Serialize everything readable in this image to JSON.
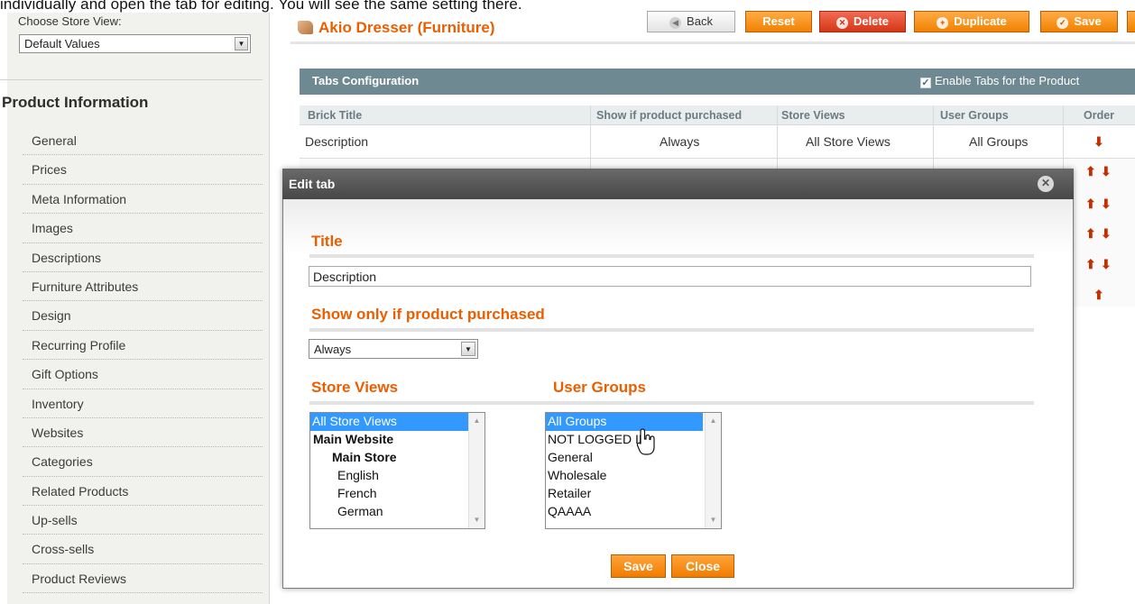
{
  "caption": "individually and open the tab for editing. You will see the same setting there.",
  "sidebar": {
    "store_view_label": "Choose Store View:",
    "store_view_value": "Default Values",
    "section_title": "Product Information",
    "items": [
      {
        "label": "General"
      },
      {
        "label": "Prices"
      },
      {
        "label": "Meta Information"
      },
      {
        "label": "Images"
      },
      {
        "label": "Descriptions"
      },
      {
        "label": "Furniture Attributes"
      },
      {
        "label": "Design"
      },
      {
        "label": "Recurring Profile"
      },
      {
        "label": "Gift Options"
      },
      {
        "label": "Inventory"
      },
      {
        "label": "Websites"
      },
      {
        "label": "Categories"
      },
      {
        "label": "Related Products"
      },
      {
        "label": "Up-sells"
      },
      {
        "label": "Cross-sells"
      },
      {
        "label": "Product Reviews"
      }
    ]
  },
  "header": {
    "product_title": "Akio Dresser (Furniture)",
    "buttons": {
      "back": "Back",
      "reset": "Reset",
      "delete": "Delete",
      "duplicate": "Duplicate",
      "save": "Save"
    }
  },
  "tabs_config": {
    "title": "Tabs Configuration",
    "enable_label": "Enable Tabs for the Product",
    "enable_checked": true,
    "columns": [
      "Brick Title",
      "Show if product purchased",
      "Store Views",
      "User Groups",
      "Order"
    ],
    "rows": [
      {
        "brick_title": "Description",
        "purchased": "Always",
        "store_views": "All Store Views",
        "user_groups": "All Groups"
      }
    ]
  },
  "modal": {
    "title": "Edit tab",
    "title_section": "Title",
    "title_value": "Description",
    "purchased_section": "Show only if product purchased",
    "purchased_value": "Always",
    "store_views_section": "Store Views",
    "store_views": [
      {
        "label": "All Store Views",
        "selected": true
      },
      {
        "label": "Main Website"
      },
      {
        "label": "Main Store"
      },
      {
        "label": "English"
      },
      {
        "label": "French"
      },
      {
        "label": "German"
      }
    ],
    "user_groups_section": "User Groups",
    "user_groups": [
      {
        "label": "All Groups",
        "selected": true
      },
      {
        "label": "NOT LOGGED IN"
      },
      {
        "label": "General"
      },
      {
        "label": "Wholesale"
      },
      {
        "label": "Retailer"
      },
      {
        "label": "QAAAA"
      }
    ],
    "save_label": "Save",
    "close_label": "Close"
  },
  "colors": {
    "accent": "#eb5e00",
    "grid_header": "#6f8992",
    "selection": "#3399ff",
    "modal_bar": "#555555"
  },
  "icons": {
    "order_down": "arrow-down-icon",
    "order_up": "arrow-up-icon"
  }
}
